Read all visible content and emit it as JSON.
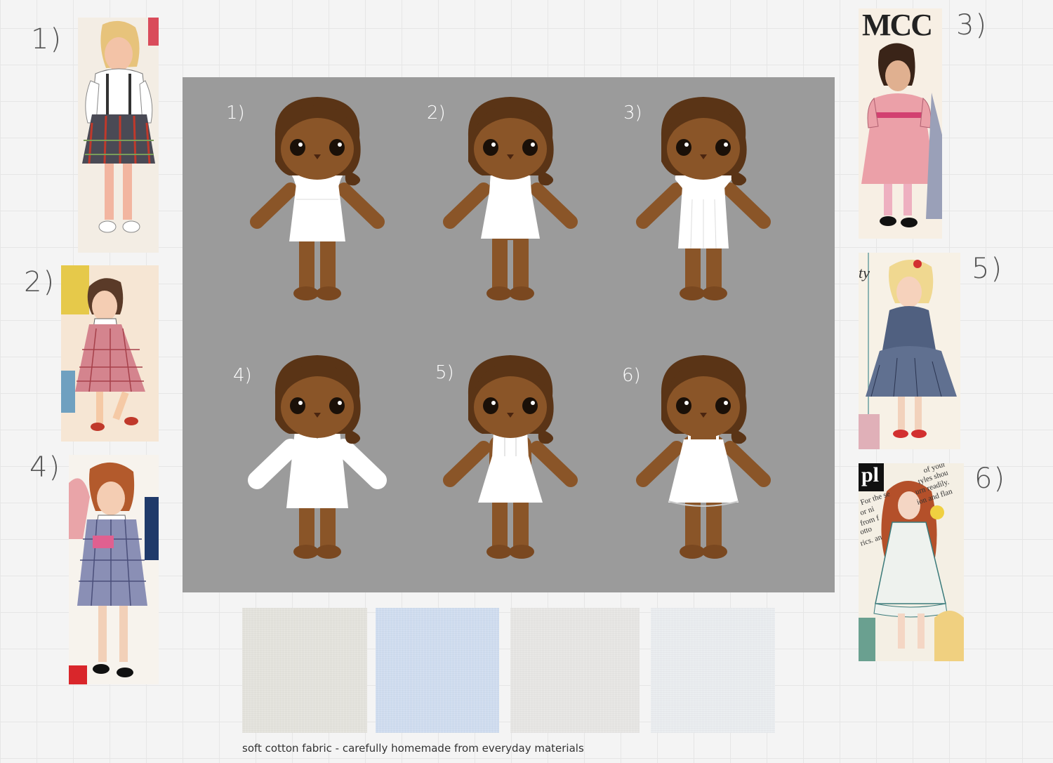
{
  "reference_labels": [
    "1)",
    "2)",
    "3)",
    "4)",
    "5)",
    "6)"
  ],
  "doll_labels": [
    "1)",
    "2)",
    "3)",
    "4)",
    "5)",
    "6)"
  ],
  "pattern_text": {
    "ref3_brand": "MCC",
    "ref5_side": "ty",
    "ref6_brand": "pl",
    "ref6_lines": [
      "of your",
      "tyles shou",
      "urn readily.",
      "ion and flan",
      "For the se",
      "or ni",
      "from f",
      "otto",
      "rics. an"
    ]
  },
  "caption": "soft cotton fabric - carefully homemade from everyday materials",
  "colors": {
    "board": "#9b9b9b",
    "skin": "#8a5528",
    "hair": "#5a3416",
    "dress": "#ffffff",
    "swatch_1": "#e3e2dc",
    "swatch_2": "#cfdcef",
    "swatch_3": "#e6e5e3",
    "swatch_4": "#e9ecef"
  }
}
